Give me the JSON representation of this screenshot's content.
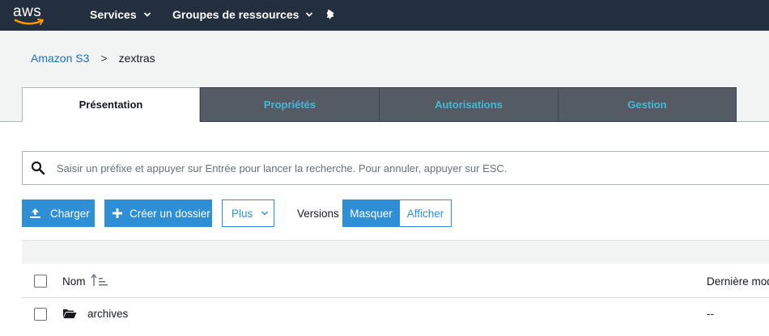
{
  "topnav": {
    "logo_text": "aws",
    "services_label": "Services",
    "groups_label": "Groupes de ressources"
  },
  "breadcrumb": {
    "root": "Amazon S3",
    "separator": ">",
    "current": "zextras"
  },
  "tabs": [
    {
      "label": "Présentation",
      "active": true
    },
    {
      "label": "Propriétés",
      "active": false
    },
    {
      "label": "Autorisations",
      "active": false
    },
    {
      "label": "Gestion",
      "active": false
    }
  ],
  "search": {
    "placeholder": "Saisir un préfixe et appuyer sur Entrée pour lancer la recherche. Pour annuler, appuyer sur ESC.",
    "value": ""
  },
  "toolbar": {
    "upload_label": "Charger",
    "create_folder_label": "Créer un dossier",
    "more_label": "Plus",
    "versions_label": "Versions",
    "hide_label": "Masquer",
    "show_label": "Afficher"
  },
  "table": {
    "columns": {
      "name": "Nom",
      "modified": "Dernière modi"
    },
    "rows": [
      {
        "name": "archives",
        "modified": "--"
      }
    ]
  },
  "colors": {
    "nav_bg": "#232f3e",
    "accent": "#2e8ed6",
    "tab_inactive_bg": "#545b64",
    "tab_inactive_text": "#44b9d6",
    "link": "#1a73b8"
  }
}
